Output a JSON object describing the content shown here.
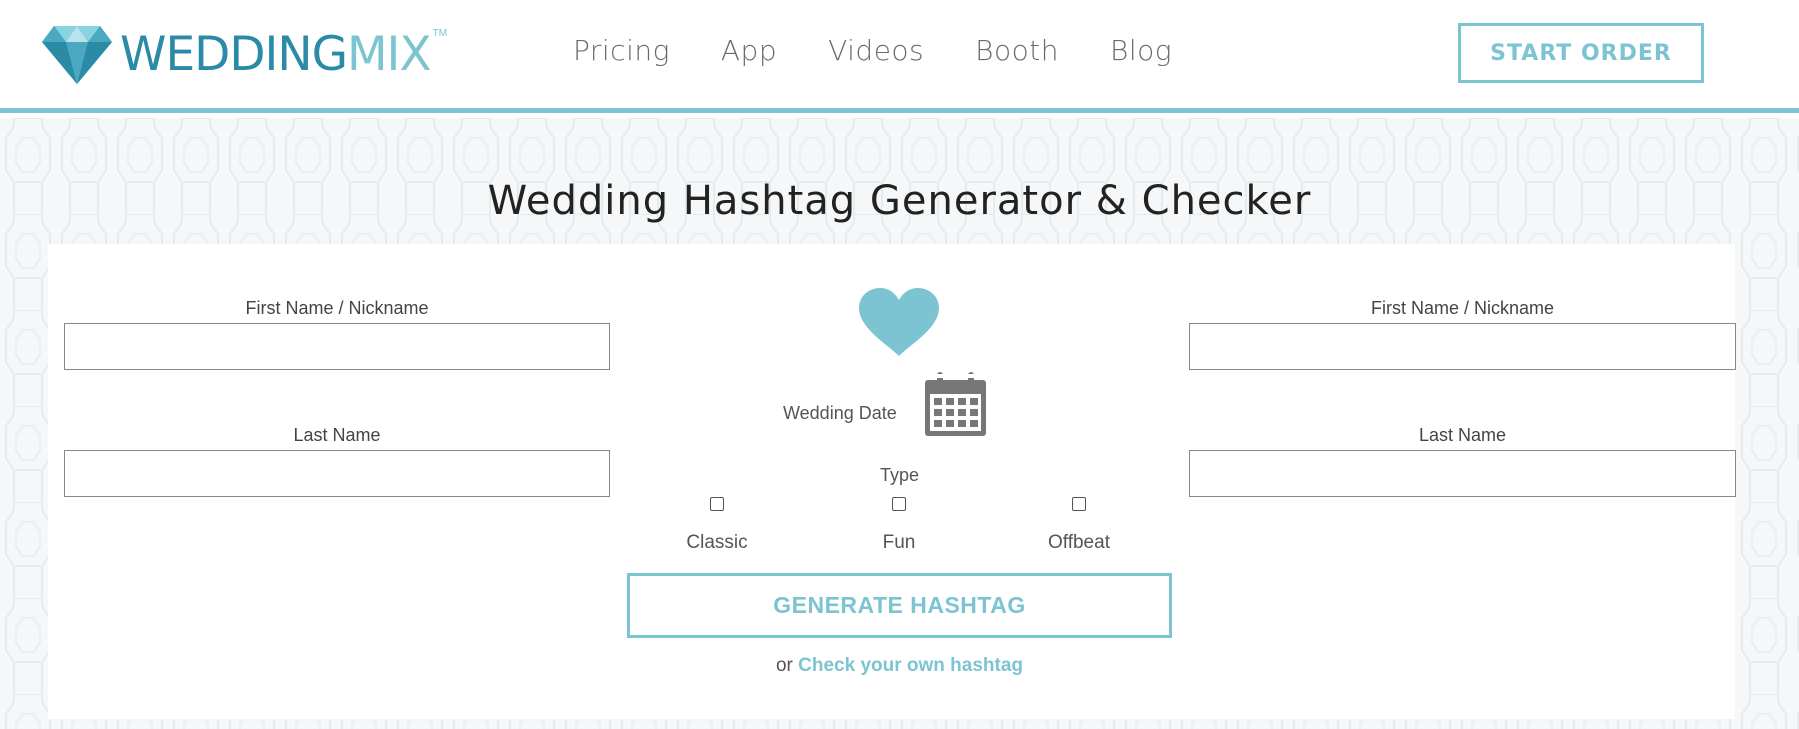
{
  "header": {
    "logo": {
      "text_part1": "WEDDING",
      "text_part2": "MIX",
      "tm": "TM"
    },
    "nav": [
      "Pricing",
      "App",
      "Videos",
      "Booth",
      "Blog"
    ],
    "cta_label": "START ORDER"
  },
  "page": {
    "title": "Wedding Hashtag Generator & Checker"
  },
  "form": {
    "left": {
      "first_label": "First Name / Nickname",
      "last_label": "Last Name",
      "first_value": "",
      "last_value": ""
    },
    "right": {
      "first_label": "First Name / Nickname",
      "last_label": "Last Name",
      "first_value": "",
      "last_value": ""
    },
    "wedding_date_label": "Wedding Date",
    "type_label": "Type",
    "types": [
      "Classic",
      "Fun",
      "Offbeat"
    ],
    "generate_label": "GENERATE HASHTAG",
    "check_prefix": "or ",
    "check_link": "Check your own hashtag"
  },
  "colors": {
    "accent": "#7cc4d2",
    "logo_dark": "#2b8aa6",
    "text": "#222222"
  },
  "icons": {
    "logo": "diamond-icon",
    "heart": "heart-icon",
    "calendar": "calendar-icon"
  }
}
